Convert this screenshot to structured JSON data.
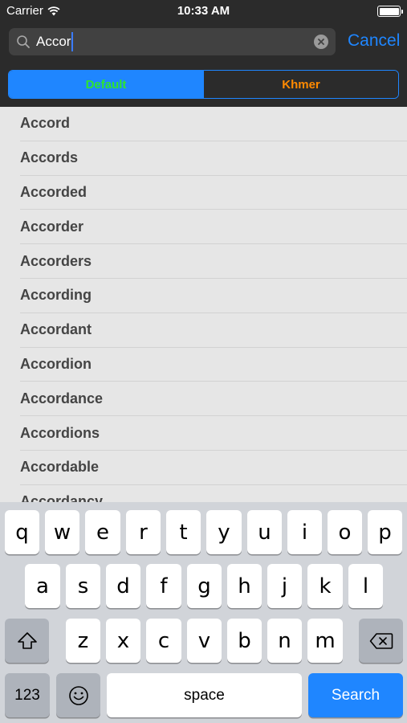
{
  "status_bar": {
    "carrier": "Carrier",
    "time": "10:33 AM",
    "icons": [
      "wifi-icon",
      "battery-icon"
    ]
  },
  "search": {
    "value": "Accor",
    "icon": "search-icon",
    "clear_icon": "clear-icon",
    "cancel_label": "Cancel"
  },
  "segments": {
    "default_label": "Default",
    "khmer_label": "Khmer",
    "selected": "Default"
  },
  "results": [
    "Accord",
    "Accords",
    "Accorded",
    "Accorder",
    "Accorders",
    "According",
    "Accordant",
    "Accordion",
    "Accordance",
    "Accordions",
    "Accordable",
    "Accordancy"
  ],
  "keyboard": {
    "row1": [
      "q",
      "w",
      "e",
      "r",
      "t",
      "y",
      "u",
      "i",
      "o",
      "p"
    ],
    "row2": [
      "a",
      "s",
      "d",
      "f",
      "g",
      "h",
      "j",
      "k",
      "l"
    ],
    "row3": [
      "z",
      "x",
      "c",
      "v",
      "b",
      "n",
      "m"
    ],
    "numbers_label": "123",
    "space_label": "space",
    "search_label": "Search",
    "icons": [
      "shift-icon",
      "backspace-icon",
      "emoji-icon"
    ]
  },
  "colors": {
    "accent": "#1f86ff",
    "default_segment_text": "#2ee52e",
    "khmer_segment_text": "#ff8a00",
    "header_bg": "#2b2b2b"
  }
}
